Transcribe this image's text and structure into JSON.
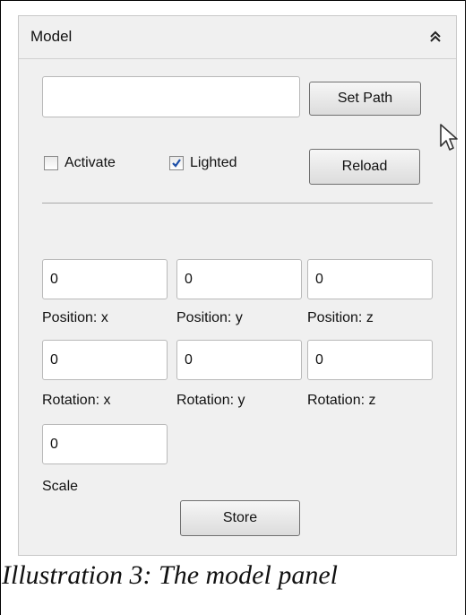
{
  "panel": {
    "title": "Model",
    "path_input": {
      "value": ""
    },
    "set_path_label": "Set Path",
    "activate": {
      "label": "Activate",
      "checked": false
    },
    "lighted": {
      "label": "Lighted",
      "checked": true
    },
    "reload_label": "Reload",
    "position": {
      "x": {
        "value": "0",
        "label": "Position: x"
      },
      "y": {
        "value": "0",
        "label": "Position: y"
      },
      "z": {
        "value": "0",
        "label": "Position: z"
      }
    },
    "rotation": {
      "x": {
        "value": "0",
        "label": "Rotation: x"
      },
      "y": {
        "value": "0",
        "label": "Rotation: y"
      },
      "z": {
        "value": "0",
        "label": "Rotation: z"
      }
    },
    "scale": {
      "value": "0",
      "label": "Scale"
    },
    "store_label": "Store"
  },
  "caption": "Illustration 3: The model panel",
  "icons": {
    "collapse": "double-chevron-up-icon",
    "cursor": "mouse-pointer-icon",
    "check": "checkmark-icon"
  }
}
